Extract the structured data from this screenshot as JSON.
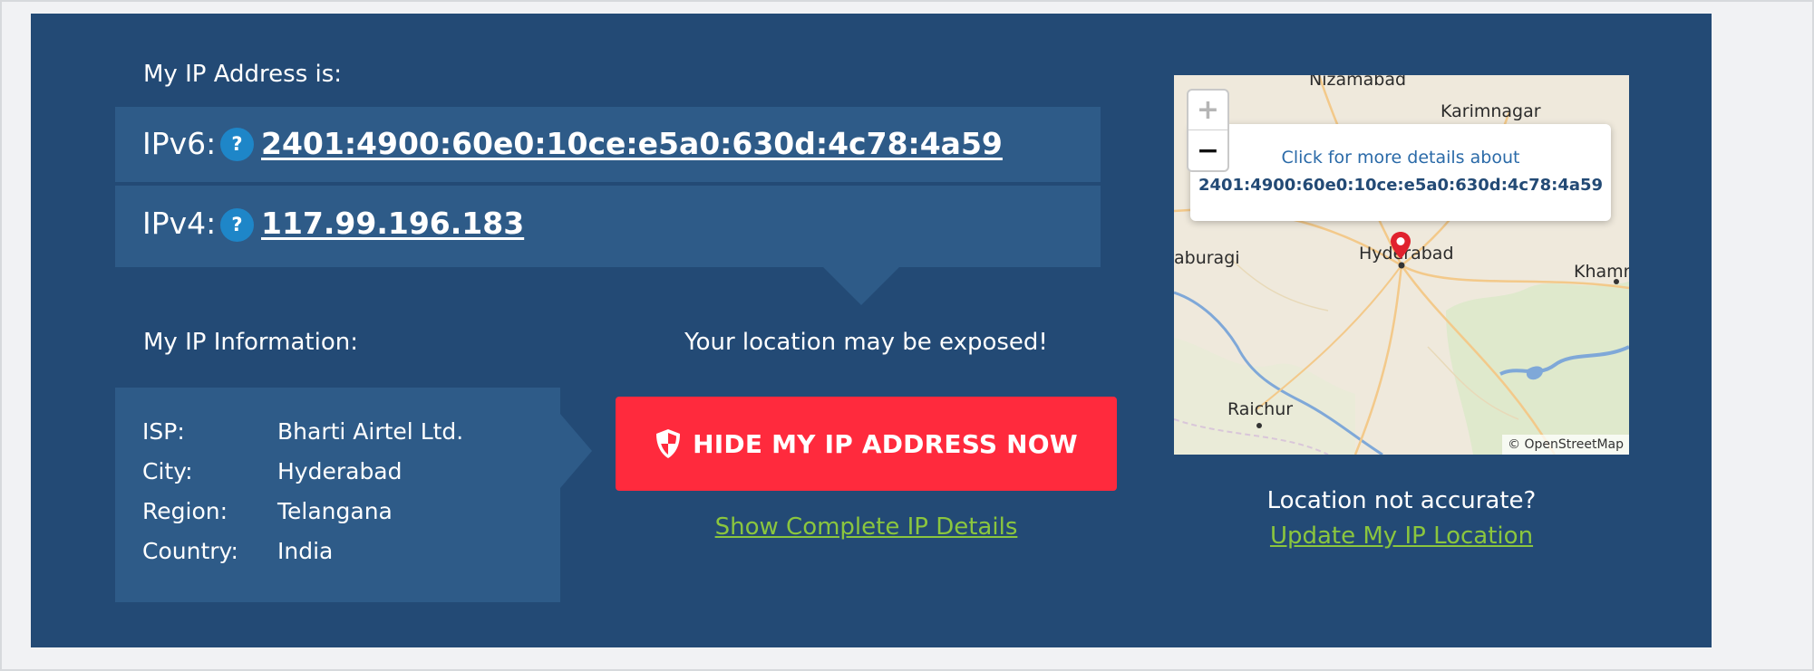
{
  "ip_section": {
    "heading": "My IP Address is:",
    "ipv6": {
      "label": "IPv6:",
      "help": "?",
      "value": "2401:4900:60e0:10ce:e5a0:630d:4c78:4a59"
    },
    "ipv4": {
      "label": "IPv4:",
      "help": "?",
      "value": "117.99.196.183"
    }
  },
  "info_section": {
    "heading": "My IP Information:",
    "rows": [
      {
        "key": "ISP:",
        "value": "Bharti Airtel Ltd."
      },
      {
        "key": "City:",
        "value": "Hyderabad"
      },
      {
        "key": "Region:",
        "value": "Telangana"
      },
      {
        "key": "Country:",
        "value": "India"
      }
    ]
  },
  "warning": {
    "text": "Your location may be exposed!",
    "button_label": "HIDE MY IP ADDRESS NOW",
    "details_link": "Show Complete IP Details"
  },
  "map": {
    "zoom_in": "+",
    "zoom_out": "−",
    "popup_line1": "Click for more details about",
    "popup_line2": "2401:4900:60e0:10ce:e5a0:630d:4c78:4a59",
    "cities": [
      "Nizamabad",
      "Karimnagar",
      "aburagi",
      "Hyderabad",
      "Khamm",
      "Raichur"
    ],
    "attribution": "© OpenStreetMap",
    "accuracy_question": "Location not accurate?",
    "update_link": "Update My IP Location"
  },
  "colors": {
    "panel": "#234a75",
    "row": "#2e5b88",
    "button": "#ff2a3d",
    "link": "#8bc63e",
    "help": "#1e86c8",
    "marker": "#e0222e"
  }
}
